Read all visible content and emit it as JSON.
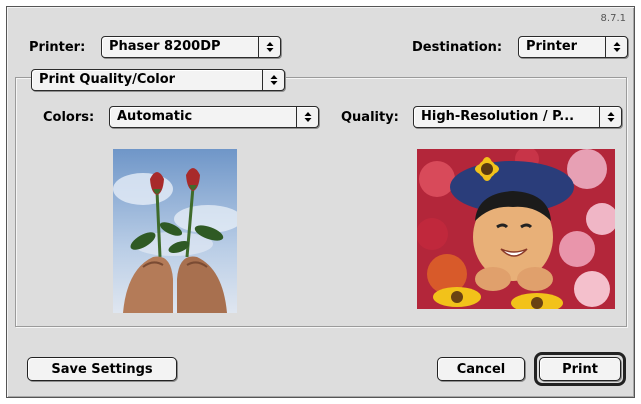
{
  "version": "8.7.1",
  "printer": {
    "label": "Printer:",
    "value": "Phaser 8200DP"
  },
  "destination": {
    "label": "Destination:",
    "value": "Printer"
  },
  "panel": {
    "value": "Print Quality/Color"
  },
  "colors": {
    "label": "Colors:",
    "value": "Automatic"
  },
  "quality": {
    "label": "Quality:",
    "value": "High-Resolution / P..."
  },
  "buttons": {
    "save": "Save Settings",
    "cancel": "Cancel",
    "print": "Print"
  },
  "previews": {
    "left": "roses-in-hands-photo",
    "right": "girl-with-flowers-photo"
  },
  "colors_theme": {
    "dialog_bg": "#dddddd",
    "control_bg": "#f3f3f3"
  }
}
